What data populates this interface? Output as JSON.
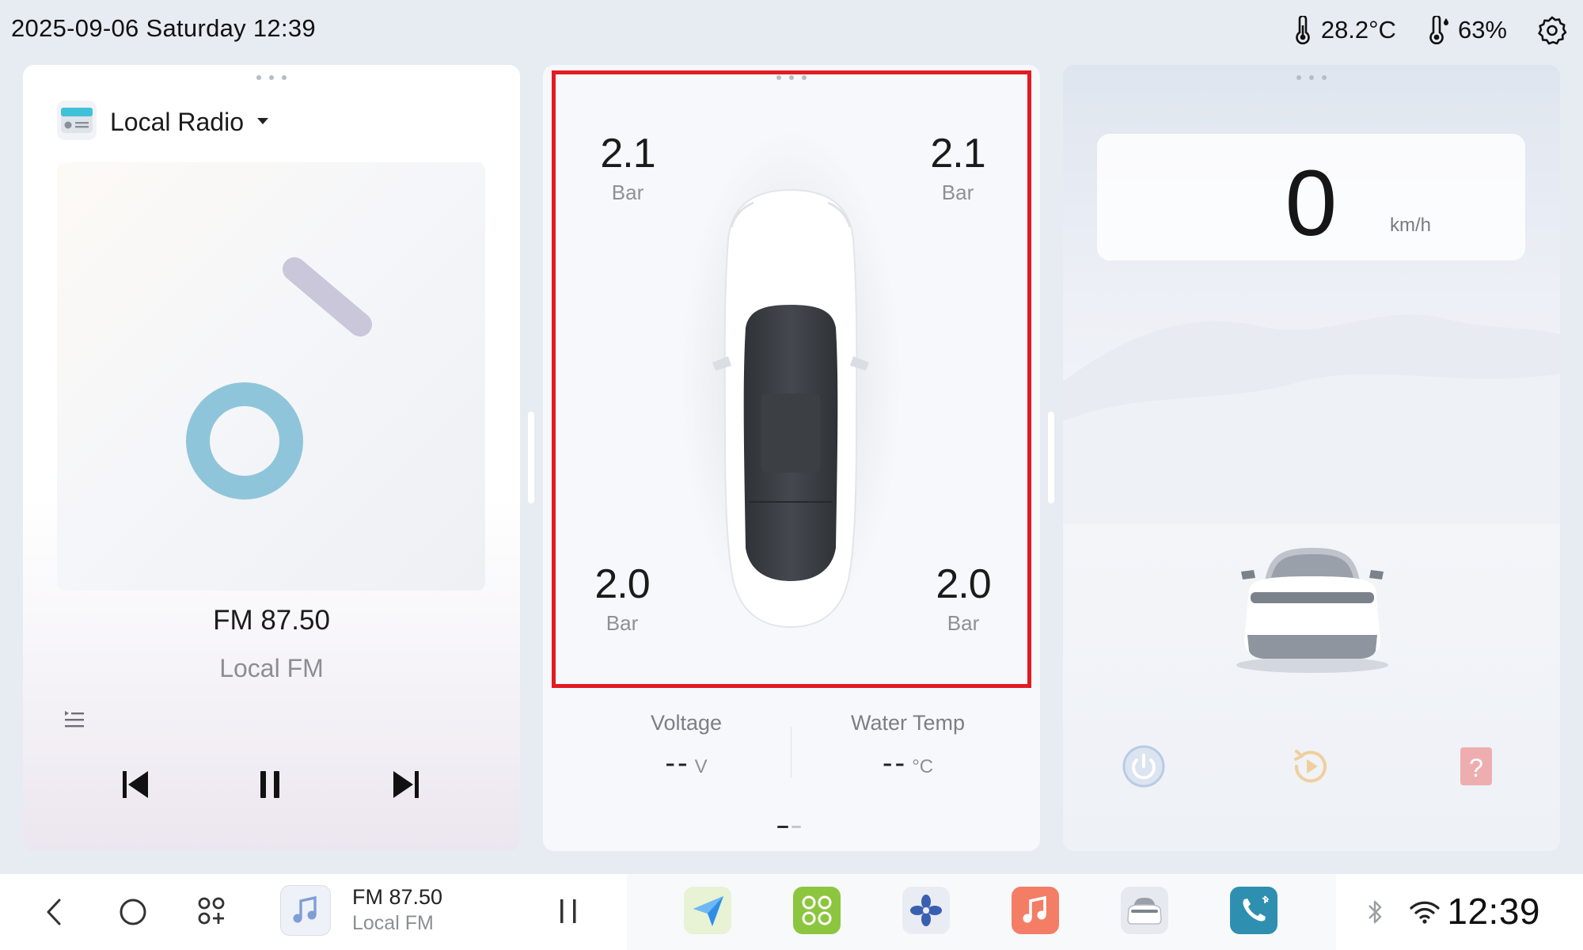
{
  "status_bar": {
    "datetime": "2025-09-06 Saturday 12:39",
    "temperature": "28.2°C",
    "humidity": "63%"
  },
  "media_card": {
    "source_label": "Local Radio",
    "frequency": "FM 87.50",
    "station": "Local FM",
    "icons": [
      "radio-icon",
      "caret-down-icon",
      "music-note-icon",
      "playlist-icon",
      "previous-icon",
      "pause-icon",
      "next-icon"
    ]
  },
  "tpms_card": {
    "front_left": {
      "pressure": "2.1",
      "unit": "Bar"
    },
    "front_right": {
      "pressure": "2.1",
      "unit": "Bar"
    },
    "rear_left": {
      "pressure": "2.0",
      "unit": "Bar"
    },
    "rear_right": {
      "pressure": "2.0",
      "unit": "Bar"
    },
    "voltage": {
      "label": "Voltage",
      "value": "--",
      "unit": "V"
    },
    "water_temp": {
      "label": "Water Temp",
      "value": "--",
      "unit": "°C"
    },
    "highlight_color": "#e21b23"
  },
  "speed_card": {
    "speed": "0",
    "unit": "km/h",
    "icons": [
      "power-icon",
      "replay-icon",
      "help-icon"
    ],
    "action_colors": {
      "power": "#b9cbe3",
      "replay": "#f0cf9e",
      "help": "#eeaeb0"
    }
  },
  "navbar": {
    "now_playing_freq": "FM 87.50",
    "now_playing_station": "Local FM",
    "clock": "12:39",
    "apps": [
      "navigation-app",
      "apps-launcher",
      "climate-fan-app",
      "music-app",
      "vehicle-app",
      "bluetooth-phone-app"
    ],
    "app_colors": {
      "navigation": "#e8f2d4",
      "launcher": "#8cc63f",
      "fan": "#e9ecf3",
      "music": "#f47d66",
      "vehicle": "#e6e9ef",
      "phone": "#2f8fb0"
    }
  }
}
